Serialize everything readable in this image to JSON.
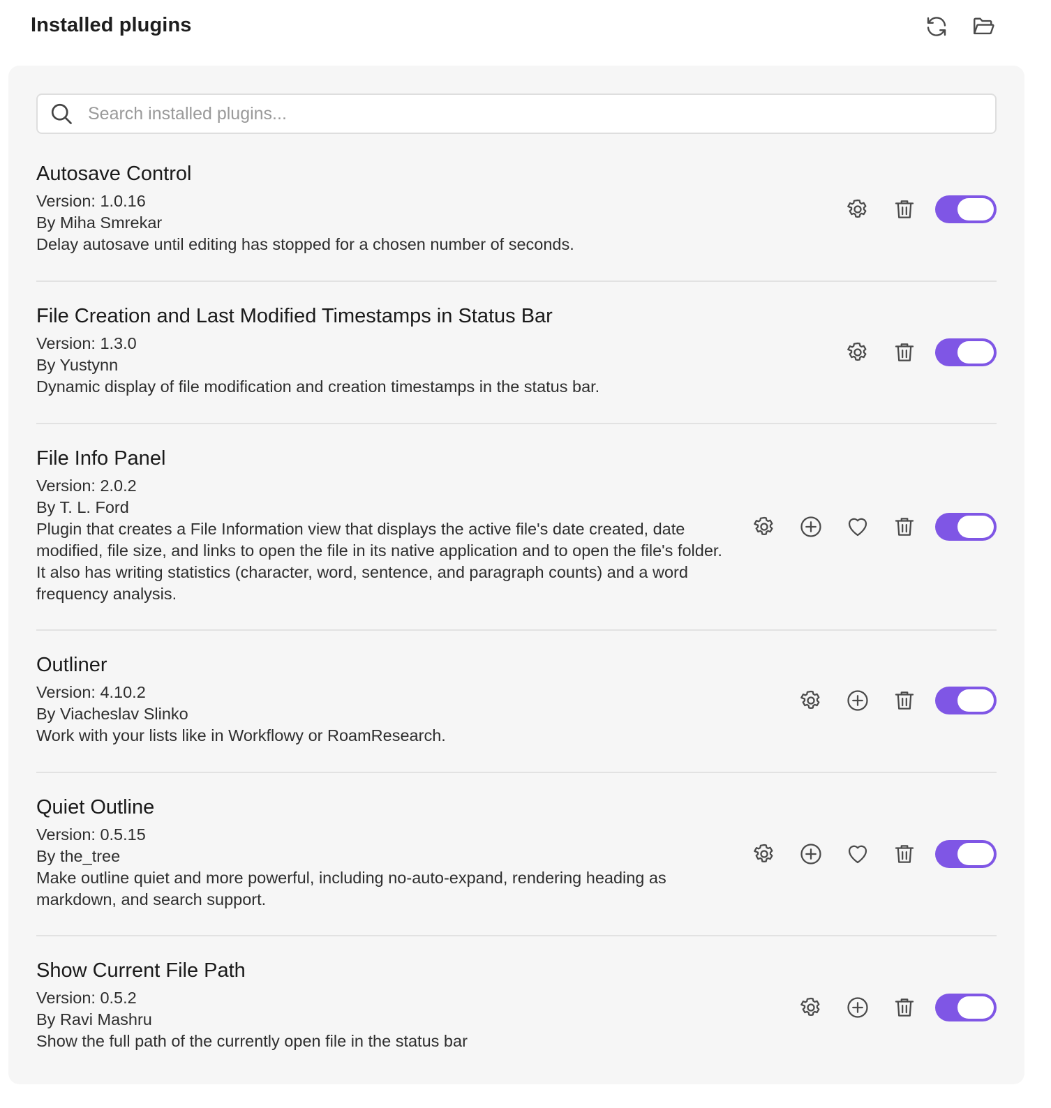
{
  "header": {
    "title": "Installed plugins",
    "actions": [
      {
        "icon": "refresh-icon"
      },
      {
        "icon": "folder-open-icon"
      }
    ]
  },
  "search": {
    "placeholder": "Search installed plugins...",
    "value": ""
  },
  "colors": {
    "accent": "#7f56e5",
    "panel_bg": "#f6f6f6",
    "divider": "#e2e2e2"
  },
  "plugins": [
    {
      "name": "Autosave Control",
      "version": "Version: 1.0.16",
      "author": "By Miha Smrekar",
      "description": "Delay autosave until editing has stopped for a chosen number of seconds.",
      "actions": [
        "gear-icon",
        "trash-icon"
      ],
      "enabled": true
    },
    {
      "name": "File Creation and Last Modified Timestamps in Status Bar",
      "version": "Version: 1.3.0",
      "author": "By Yustynn",
      "description": "Dynamic display of file modification and creation timestamps in the status bar.",
      "actions": [
        "gear-icon",
        "trash-icon"
      ],
      "enabled": true
    },
    {
      "name": "File Info Panel",
      "version": "Version: 2.0.2",
      "author": "By T. L. Ford",
      "description": "Plugin that creates a File Information view that displays the active file's date created, date modified, file size, and links to open the file in its native application and to open the file's folder. It also has writing statistics (character, word, sentence, and paragraph counts) and a word frequency analysis.",
      "actions": [
        "gear-icon",
        "plus-circle-icon",
        "heart-icon",
        "trash-icon"
      ],
      "enabled": true
    },
    {
      "name": "Outliner",
      "version": "Version: 4.10.2",
      "author": "By Viacheslav Slinko",
      "description": "Work with your lists like in Workflowy or RoamResearch.",
      "actions": [
        "gear-icon",
        "plus-circle-icon",
        "trash-icon"
      ],
      "enabled": true
    },
    {
      "name": "Quiet Outline",
      "version": "Version: 0.5.15",
      "author": "By the_tree",
      "description": "Make outline quiet and more powerful, including no-auto-expand, rendering heading as markdown, and search support.",
      "actions": [
        "gear-icon",
        "plus-circle-icon",
        "heart-icon",
        "trash-icon"
      ],
      "enabled": true
    },
    {
      "name": "Show Current File Path",
      "version": "Version: 0.5.2",
      "author": "By Ravi Mashru",
      "description": "Show the full path of the currently open file in the status bar",
      "actions": [
        "gear-icon",
        "plus-circle-icon",
        "trash-icon"
      ],
      "enabled": true
    }
  ]
}
